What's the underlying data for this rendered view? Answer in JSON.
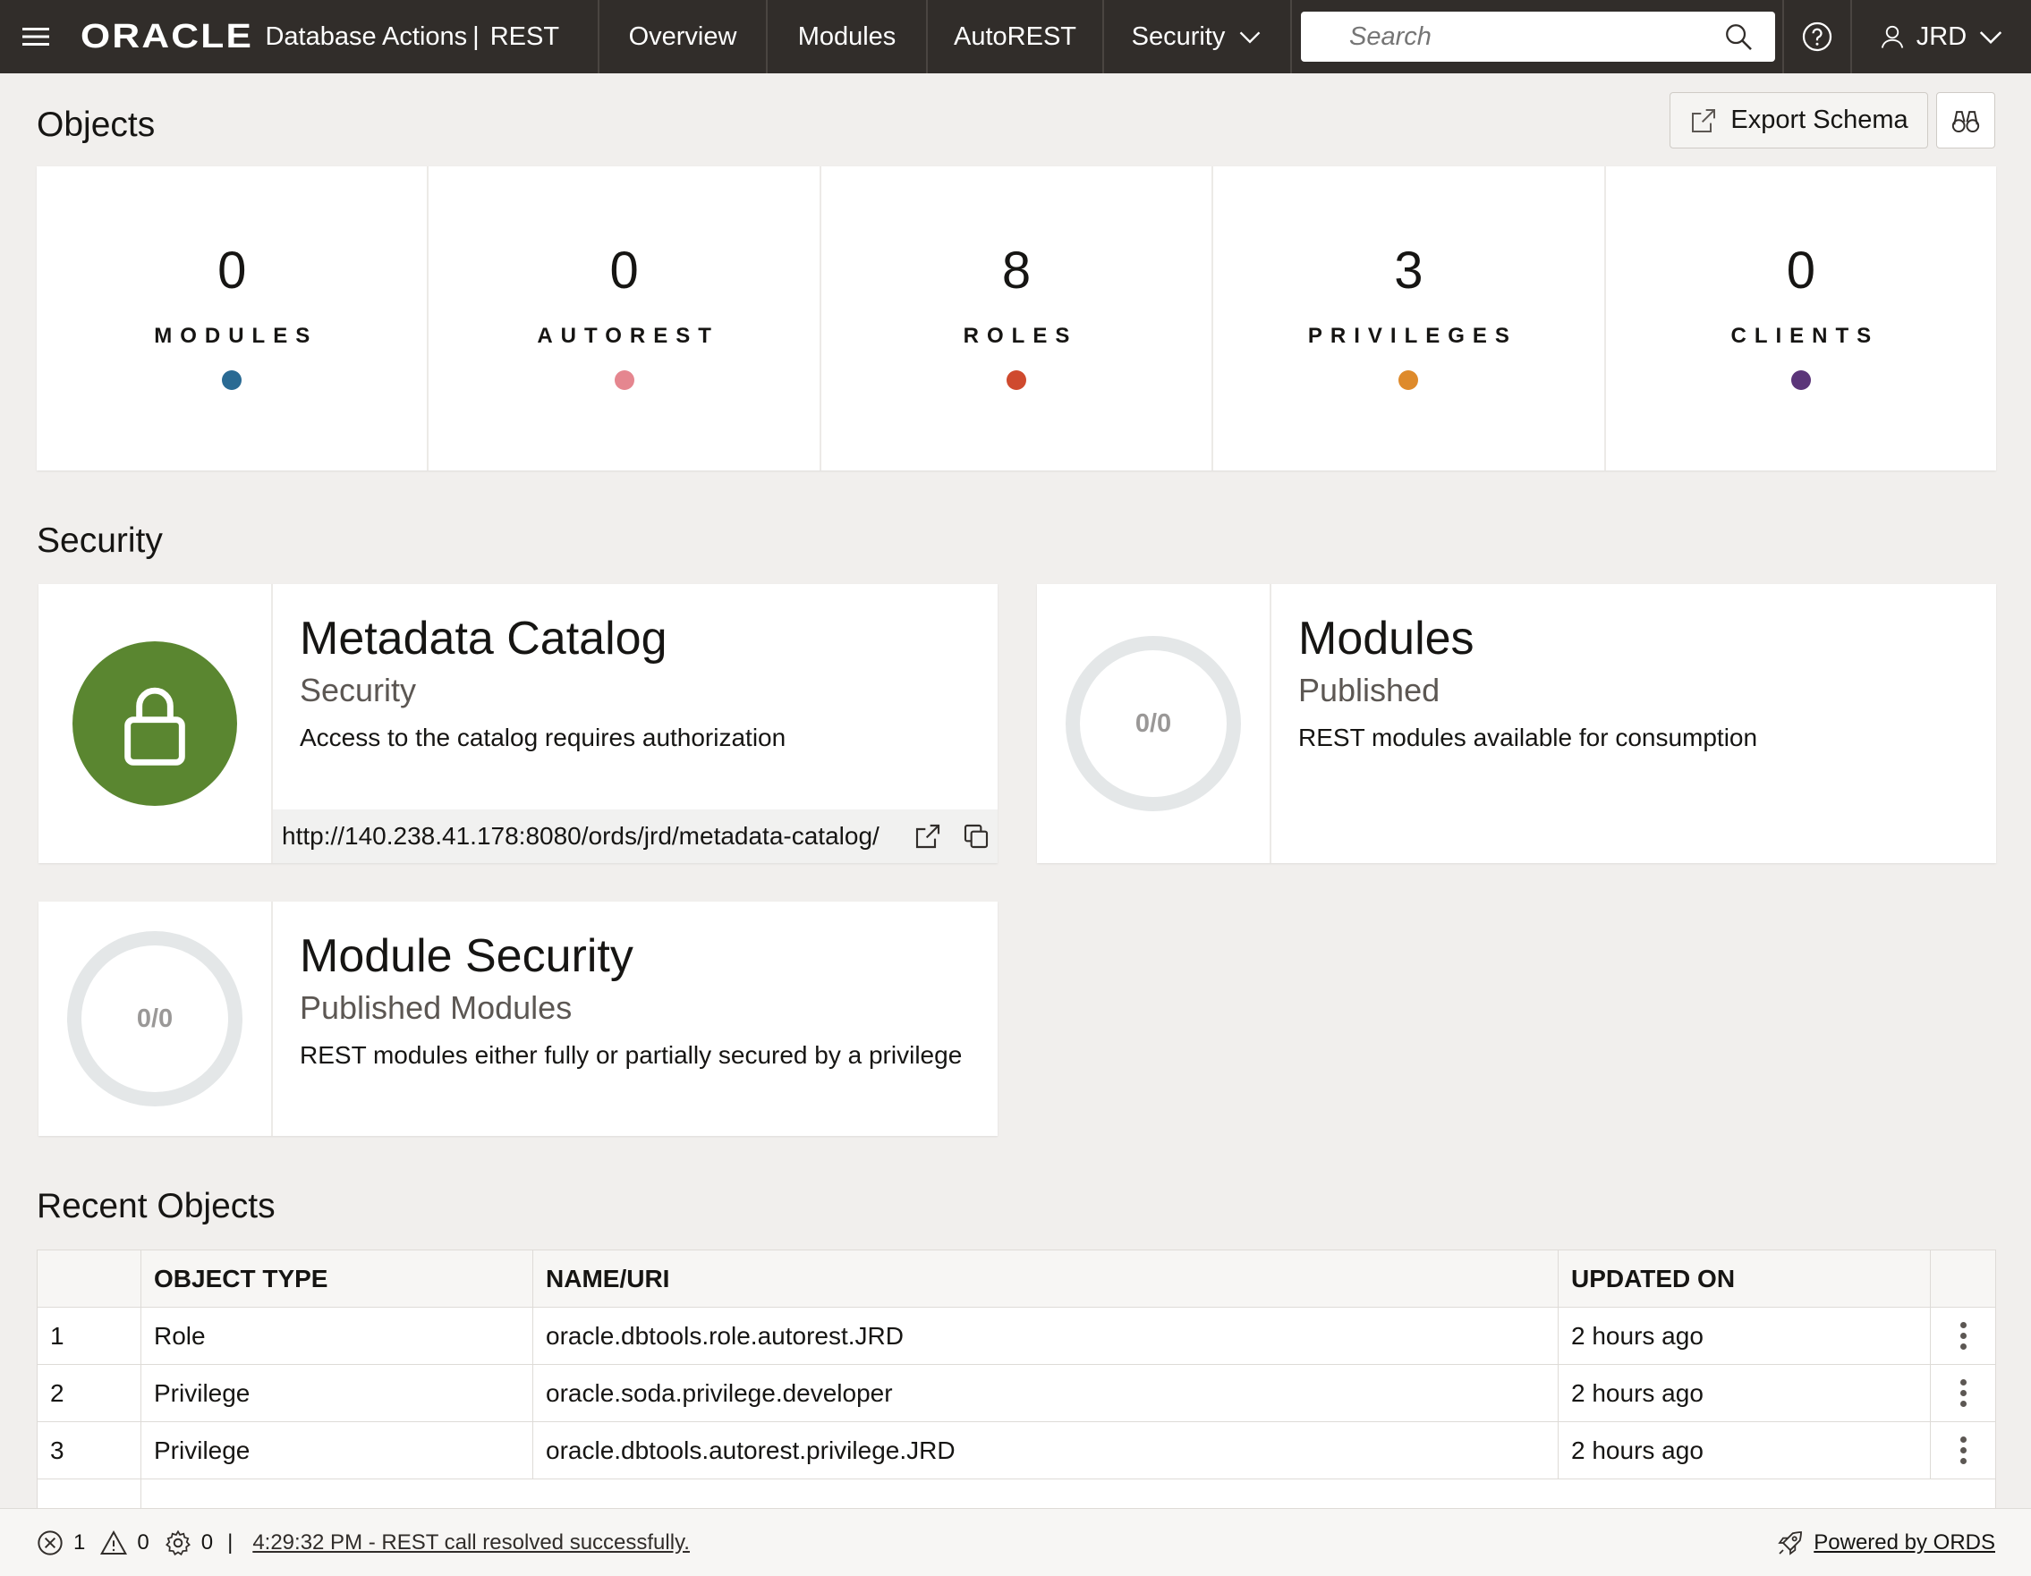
{
  "header": {
    "logo": "ORACLE",
    "app_name": "Database Actions",
    "separator": "|",
    "sub_app": "REST",
    "nav": {
      "overview": "Overview",
      "modules": "Modules",
      "autorest": "AutoREST",
      "security": "Security"
    },
    "search_placeholder": "Search",
    "user": "JRD"
  },
  "objects": {
    "title": "Objects",
    "export_label": "Export Schema",
    "stats": [
      {
        "value": "0",
        "label": "MODULES",
        "color": "#2a6a93"
      },
      {
        "value": "0",
        "label": "AUTOREST",
        "color": "#e5868f"
      },
      {
        "value": "8",
        "label": "ROLES",
        "color": "#cf4a2e"
      },
      {
        "value": "3",
        "label": "PRIVILEGES",
        "color": "#de8a2b"
      },
      {
        "value": "0",
        "label": "CLIENTS",
        "color": "#5b3579"
      }
    ]
  },
  "security": {
    "title": "Security",
    "cards": {
      "metadata": {
        "title": "Metadata Catalog",
        "subtitle": "Security",
        "description": "Access to the catalog requires authorization",
        "url": "http://140.238.41.178:8080/ords/jrd/metadata-catalog/"
      },
      "modules": {
        "title": "Modules",
        "subtitle": "Published",
        "description": "REST modules available for consumption",
        "ring": "0/0"
      },
      "module_security": {
        "title": "Module Security",
        "subtitle": "Published Modules",
        "description": "REST modules either fully or partially secured by a privilege",
        "ring": "0/0"
      }
    }
  },
  "recent": {
    "title": "Recent Objects",
    "columns": [
      "",
      "OBJECT TYPE",
      "NAME/URI",
      "UPDATED ON"
    ],
    "rows": [
      {
        "index": "1",
        "type": "Role",
        "name": "oracle.dbtools.role.autorest.JRD",
        "updated": "2 hours ago"
      },
      {
        "index": "2",
        "type": "Privilege",
        "name": "oracle.soda.privilege.developer",
        "updated": "2 hours ago"
      },
      {
        "index": "3",
        "type": "Privilege",
        "name": "oracle.dbtools.autorest.privilege.JRD",
        "updated": "2 hours ago"
      }
    ]
  },
  "footer": {
    "errors": "1",
    "warnings": "0",
    "tasks": "0",
    "divider": "|",
    "message": "4:29:32 PM - REST call resolved successfully.",
    "powered": "Powered by ORDS"
  }
}
